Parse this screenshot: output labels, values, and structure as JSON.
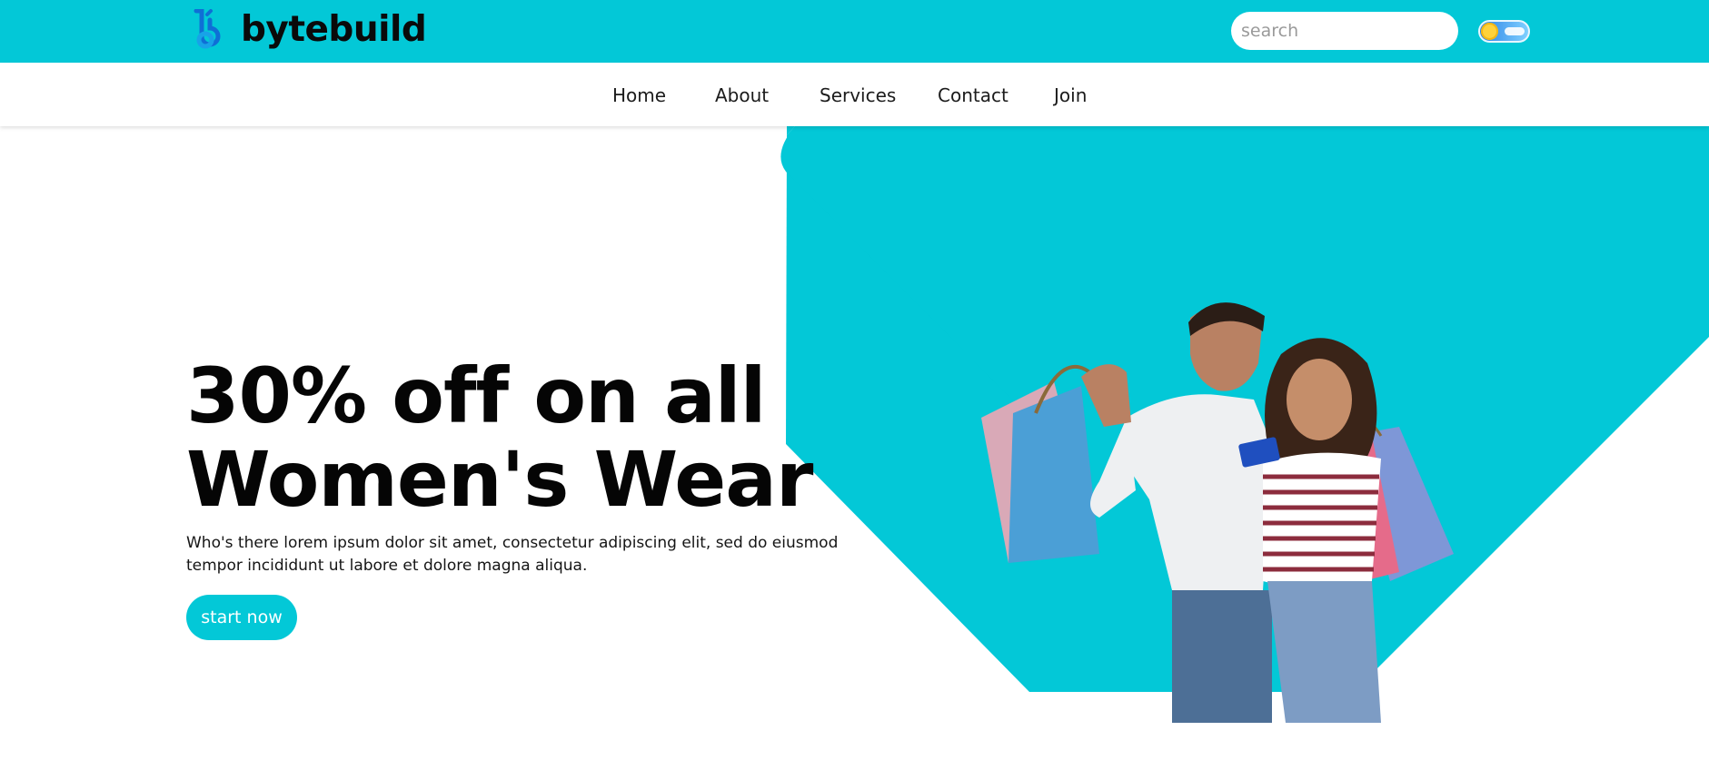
{
  "colors": {
    "accent": "#03c8d7",
    "text": "#050505",
    "background": "#ffffff"
  },
  "header": {
    "brand": "bytebuild",
    "logo_icon": "bytebuild-logo-icon",
    "search": {
      "placeholder": "search",
      "value": "",
      "icon": "search-icon"
    },
    "theme_toggle": {
      "state": "light",
      "icon": "sun-cloud-toggle"
    }
  },
  "nav": {
    "items": [
      {
        "label": "Home"
      },
      {
        "label": "About"
      },
      {
        "label": "Services"
      },
      {
        "label": "Contact"
      },
      {
        "label": "Join"
      }
    ]
  },
  "hero": {
    "headline_line1": "30% off on all",
    "headline_line2": "Women's Wear",
    "description": "Who's there lorem ipsum dolor sit amet, consectetur adipiscing elit, sed do eiusmod tempor incididunt ut labore et dolore magna aliqua.",
    "cta_label": "start now",
    "image": "couple-with-shopping-bags-photo"
  }
}
